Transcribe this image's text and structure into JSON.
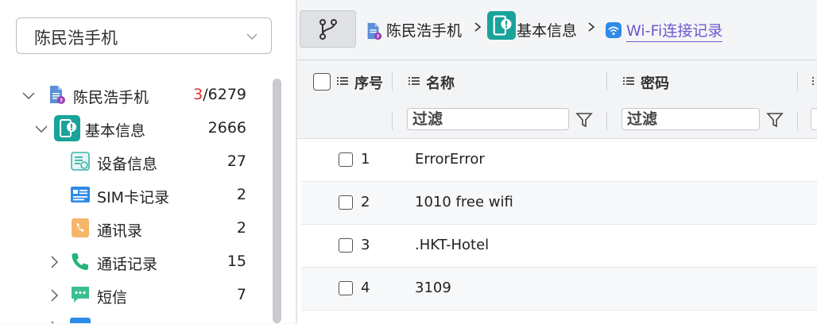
{
  "device_select": {
    "value": "陈民浩手机"
  },
  "tree": {
    "items": [
      {
        "label": "陈民浩手机",
        "count_highlight": "3",
        "count_rest": "/6279",
        "icon": "phone-report-icon"
      },
      {
        "label": "基本信息",
        "count": "2666",
        "icon": "basic-info-icon"
      },
      {
        "label": "设备信息",
        "count": "27",
        "icon": "device-info-icon"
      },
      {
        "label": "SIM卡记录",
        "count": "2",
        "icon": "sim-card-icon"
      },
      {
        "label": "通讯录",
        "count": "2",
        "icon": "contacts-icon"
      },
      {
        "label": "通话记录",
        "count": "15",
        "icon": "phone-call-icon"
      },
      {
        "label": "短信",
        "count": "7",
        "icon": "sms-icon"
      }
    ]
  },
  "breadcrumb": {
    "items": [
      "陈民浩手机",
      "基本信息",
      "Wi-Fi连接记录"
    ]
  },
  "grid": {
    "columns": [
      "序号",
      "名称",
      "密码"
    ],
    "filter_placeholder": "过滤",
    "rows": [
      {
        "index": "1",
        "name": "ErrorError"
      },
      {
        "index": "2",
        "name": "1010 free wifi"
      },
      {
        "index": "3",
        "name": ".HKT-Hotel"
      },
      {
        "index": "4",
        "name": "3109"
      }
    ]
  },
  "colors": {
    "accent_purple": "#6a5acd",
    "count_red": "#e5322d",
    "teal": "#1aa39a"
  }
}
